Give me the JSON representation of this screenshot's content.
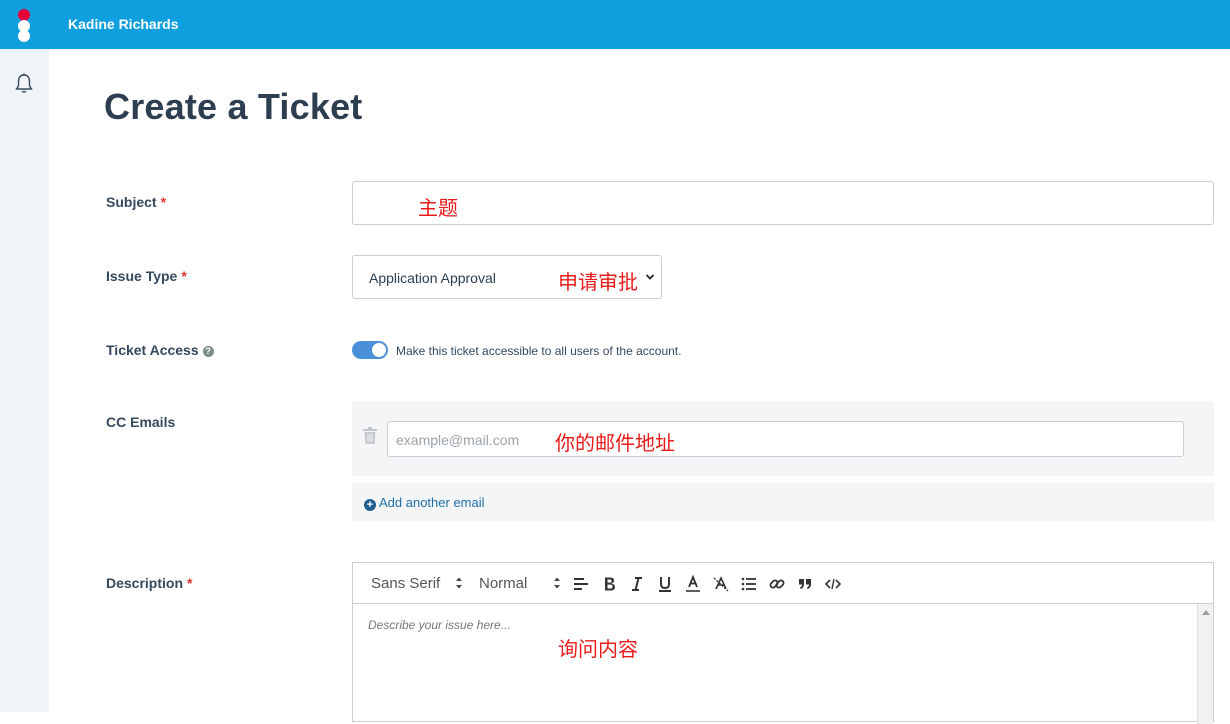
{
  "header": {
    "user_name": "Kadine Richards",
    "logo_colors": [
      "#e4003b",
      "#ffffff",
      "#ffffff"
    ],
    "bar_color": "#109fde"
  },
  "sidebar": {
    "icons": [
      "bell-icon"
    ]
  },
  "page": {
    "title": "Create a Ticket"
  },
  "form": {
    "subject": {
      "label": "Subject",
      "required_mark": "*",
      "value": "",
      "annotation": "主题"
    },
    "issue_type": {
      "label": "Issue Type",
      "required_mark": "*",
      "selected": "Application Approval",
      "annotation": "申请审批"
    },
    "ticket_access": {
      "label": "Ticket Access",
      "help_icon": "?",
      "toggle_on": true,
      "toggle_text": "Make this ticket accessible to all users of the account."
    },
    "cc_emails": {
      "label": "CC Emails",
      "placeholder": "example@mail.com",
      "annotation": "你的邮件地址",
      "add_button": "Add another email",
      "add_icon": "+"
    },
    "description": {
      "label": "Description",
      "required_mark": "*",
      "font_select": "Sans Serif",
      "size_select": "Normal",
      "toolbar_buttons": [
        "align-icon",
        "bold-icon",
        "italic-icon",
        "underline-icon",
        "text-color-icon",
        "clear-format-icon",
        "list-icon",
        "link-icon",
        "quote-icon",
        "code-icon"
      ],
      "placeholder": "Describe your issue here...",
      "annotation": "询问内容"
    }
  },
  "colors": {
    "accent": "#4a90d9",
    "annotation": "#e81c1c",
    "required": "#e03131",
    "link": "#1f6fa8"
  }
}
